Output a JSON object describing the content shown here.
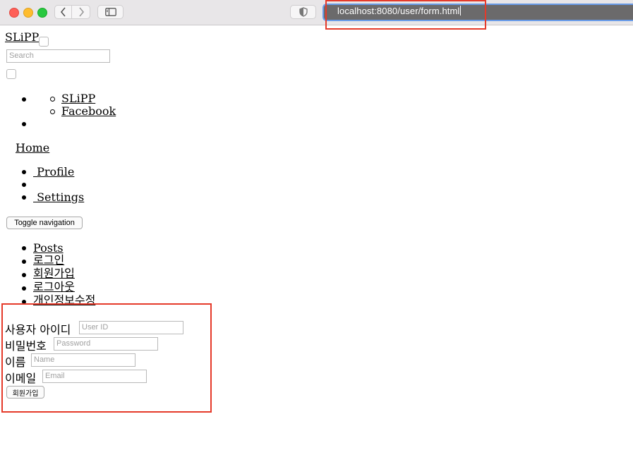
{
  "browser": {
    "url": "localhost:8080/user/form.html"
  },
  "navbar": {
    "brand": "SLiPP",
    "search_placeholder": "Search",
    "submenu": [
      "SLiPP",
      "Facebook"
    ],
    "home": "Home",
    "user_menu": [
      " Profile",
      " Settings"
    ],
    "toggle": "Toggle navigation",
    "links": [
      "Posts",
      "로그인",
      "회원가입",
      "로그아웃",
      "개인정보수정"
    ]
  },
  "form": {
    "userid_label": "사용자 아이디",
    "userid_placeholder": "User ID",
    "password_label": "비밀번호",
    "password_placeholder": "Password",
    "name_label": "이름",
    "name_placeholder": "Name",
    "email_label": "이메일",
    "email_placeholder": "Email",
    "submit": "회원가입"
  },
  "colors": {
    "highlight": "#e53a2a",
    "link": "#0000ee"
  }
}
